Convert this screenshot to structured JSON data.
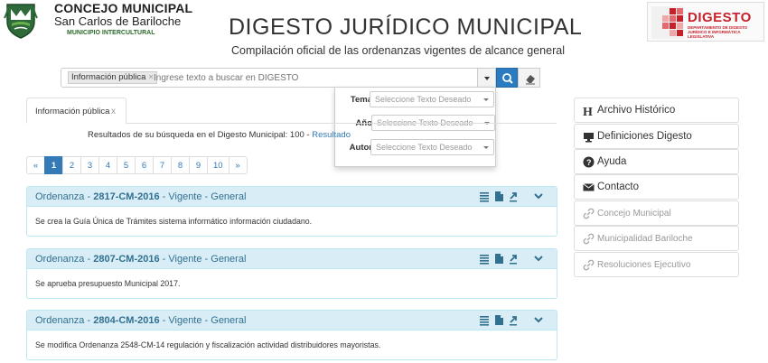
{
  "header": {
    "org_line1": "CONCEJO MUNICIPAL",
    "org_line2": "San Carlos de Bariloche",
    "org_line3": "MUNICIPIO INTERCULTURAL",
    "title": "DIGESTO JURÍDICO MUNICIPAL",
    "subtitle": "Compilación oficial de las ordenanzas vigentes de alcance general",
    "brand_logo_text": "DIGESTO",
    "brand_logo_sub": "DEPARTAMENTO DE DIGESTO JURÍDICO E INFORMÁTICA LEGISLATIVA"
  },
  "search": {
    "chip_label": "Información pública",
    "chip_remove": "×",
    "placeholder": "Ingrese texto a buscar en DIGESTO",
    "value": ""
  },
  "filters": [
    {
      "label": "Tema",
      "placeholder": "Seleccione Texto Deseado"
    },
    {
      "label": "Año",
      "placeholder": "Seleccione Texto Deseado"
    },
    {
      "label": "Autor",
      "placeholder": "Seleccione Texto Deseado"
    }
  ],
  "tab": {
    "label": "Información pública",
    "close": "x"
  },
  "results": {
    "prefix": "Resultados de su búsqueda en el Digesto Municipal: 100 - ",
    "link": "Resultado"
  },
  "pagination": [
    "«",
    "1",
    "2",
    "3",
    "4",
    "5",
    "6",
    "7",
    "8",
    "9",
    "10",
    "»"
  ],
  "pagination_active": "1",
  "cards": [
    {
      "type": "Ordenanza",
      "sep1": " - ",
      "number": "2817-CM-2016",
      "sep2": " - ",
      "status": "Vigente - General",
      "summary": "Se crea la Guía Única de Trámites sistema informático información ciudadano."
    },
    {
      "type": "Ordenanza",
      "sep1": " - ",
      "number": "2807-CM-2016",
      "sep2": " - ",
      "status": "Vigente - General",
      "summary": "Se aprueba presupuesto Municipal 2017."
    },
    {
      "type": "Ordenanza",
      "sep1": " - ",
      "number": "2804-CM-2016",
      "sep2": " - ",
      "status": "Vigente - General",
      "summary": "Se modifica Ordenanza 2548-CM-14 regulación y fiscalización actividad distribuidores mayoristas."
    }
  ],
  "sidebar": [
    {
      "label": "Archivo Histórico",
      "icon": "h-icon"
    },
    {
      "label": "Definiciones Digesto",
      "icon": "monitor-icon"
    },
    {
      "label": "Ayuda",
      "icon": "question-icon"
    },
    {
      "label": "Contacto",
      "icon": "envelope-icon"
    },
    {
      "label": "Concejo Municipal",
      "icon": "link-icon"
    },
    {
      "label": "Municipalidad Bariloche",
      "icon": "link-icon"
    },
    {
      "label": "Resoluciones Ejecutivo",
      "icon": "link-icon"
    }
  ],
  "colors": {
    "accent": "#337ab7",
    "card_header": "#d9edf7",
    "card_title": "#31708f",
    "brand_red": "#c8202a"
  }
}
